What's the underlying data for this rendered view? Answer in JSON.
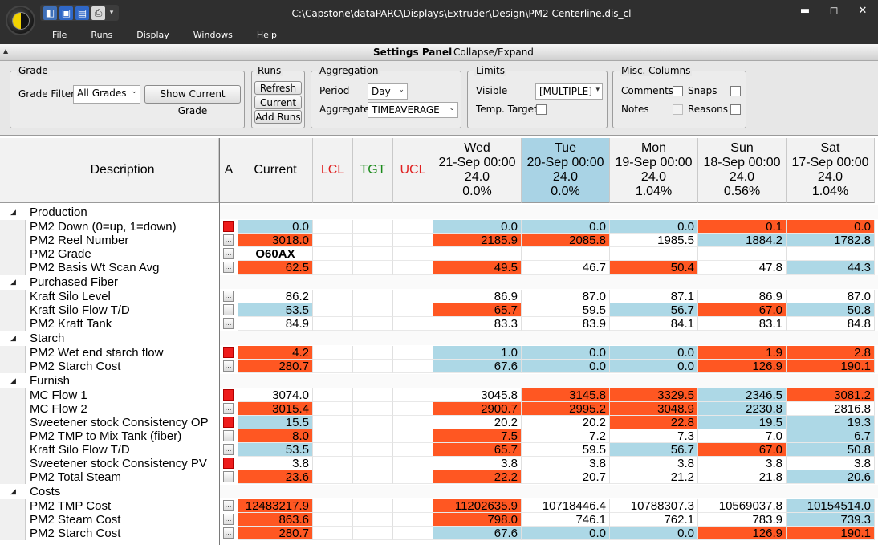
{
  "window": {
    "title": "C:\\Capstone\\dataPARC\\Displays\\Extruder\\Design\\PM2 Centerline.dis_cl",
    "menu": [
      "File",
      "Runs",
      "Display",
      "Windows",
      "Help"
    ],
    "controls": {
      "minimize": "▬",
      "restore": "◻",
      "close": "✕"
    }
  },
  "settings": {
    "title": "Settings Panel",
    "collapse_label": "Collapse/Expand",
    "grade": {
      "title": "Grade",
      "filter_label": "Grade Filter",
      "filter_value": "All Grades",
      "show_current": "Show Current Grade"
    },
    "runs": {
      "title": "Runs",
      "refresh": "Refresh",
      "current": "Current",
      "add_runs": "Add Runs"
    },
    "aggregation": {
      "title": "Aggregation",
      "period_label": "Period",
      "period_value": "Day",
      "aggregate_label": "Aggregate",
      "aggregate_value": "TIMEAVERAGE"
    },
    "limits": {
      "title": "Limits",
      "visible_label": "Visible",
      "visible_value": "[MULTIPLE]",
      "temp_target_label": "Temp. Target"
    },
    "misc": {
      "title": "Misc. Columns",
      "comments": "Comments",
      "snaps": "Snaps",
      "notes": "Notes",
      "reasons": "Reasons"
    }
  },
  "grid": {
    "headers": {
      "description": "Description",
      "a": "A",
      "current": "Current",
      "lcl": "LCL",
      "tgt": "TGT",
      "ucl": "UCL"
    },
    "header_colors": {
      "lcl": "#e02020",
      "tgt": "#1a8a1a",
      "ucl": "#e02020"
    },
    "days": [
      {
        "day": "Wed",
        "date": "21-Sep 00:00",
        "hours": "24.0",
        "pct": "0.0%",
        "selected": false
      },
      {
        "day": "Tue",
        "date": "20-Sep 00:00",
        "hours": "24.0",
        "pct": "0.0%",
        "selected": true
      },
      {
        "day": "Mon",
        "date": "19-Sep 00:00",
        "hours": "24.0",
        "pct": "1.04%",
        "selected": false
      },
      {
        "day": "Sun",
        "date": "18-Sep 00:00",
        "hours": "24.0",
        "pct": "0.56%",
        "selected": false
      },
      {
        "day": "Sat",
        "date": "17-Sep 00:00",
        "hours": "24.0",
        "pct": "1.04%",
        "selected": false
      }
    ],
    "groups": [
      {
        "name": "Production",
        "rows": [
          {
            "desc": "PM2 Down (0=up, 1=down)",
            "a": "red",
            "current": {
              "v": "0.0",
              "c": "blue"
            },
            "days": [
              [
                "0.0",
                "blue"
              ],
              [
                "0.0",
                "blue"
              ],
              [
                "0.0",
                "blue"
              ],
              [
                "0.1",
                "orange"
              ],
              [
                "0.0",
                "orange"
              ]
            ]
          },
          {
            "desc": "PM2 Reel Number",
            "a": "btn",
            "current": {
              "v": "3018.0",
              "c": "orange"
            },
            "days": [
              [
                "2185.9",
                "orange"
              ],
              [
                "2085.8",
                "orange"
              ],
              [
                "1985.5",
                "white"
              ],
              [
                "1884.2",
                "blue"
              ],
              [
                "1782.8",
                "blue"
              ]
            ]
          },
          {
            "desc": "PM2 Grade",
            "a": "btn",
            "current": {
              "v": "O60AX",
              "c": "white",
              "bold": true,
              "center": true
            },
            "days": [
              [
                "",
                "white"
              ],
              [
                "",
                "white"
              ],
              [
                "",
                "white"
              ],
              [
                "",
                "white"
              ],
              [
                "",
                "white"
              ]
            ]
          },
          {
            "desc": "PM2 Basis Wt Scan Avg",
            "a": "btn",
            "current": {
              "v": "62.5",
              "c": "orange"
            },
            "days": [
              [
                "49.5",
                "orange"
              ],
              [
                "46.7",
                "white"
              ],
              [
                "50.4",
                "orange"
              ],
              [
                "47.8",
                "white"
              ],
              [
                "44.3",
                "blue"
              ]
            ]
          }
        ]
      },
      {
        "name": "Purchased Fiber",
        "rows": [
          {
            "desc": "Kraft Silo Level",
            "a": "btn",
            "current": {
              "v": "86.2",
              "c": "white"
            },
            "days": [
              [
                "86.9",
                "white"
              ],
              [
                "87.0",
                "white"
              ],
              [
                "87.1",
                "white"
              ],
              [
                "86.9",
                "white"
              ],
              [
                "87.0",
                "white"
              ]
            ]
          },
          {
            "desc": "Kraft Silo Flow T/D",
            "a": "btn",
            "current": {
              "v": "53.5",
              "c": "blue"
            },
            "days": [
              [
                "65.7",
                "orange"
              ],
              [
                "59.5",
                "white"
              ],
              [
                "56.7",
                "blue"
              ],
              [
                "67.0",
                "orange"
              ],
              [
                "50.8",
                "blue"
              ]
            ]
          },
          {
            "desc": "PM2 Kraft Tank",
            "a": "btn",
            "current": {
              "v": "84.9",
              "c": "white"
            },
            "days": [
              [
                "83.3",
                "white"
              ],
              [
                "83.9",
                "white"
              ],
              [
                "84.1",
                "white"
              ],
              [
                "83.1",
                "white"
              ],
              [
                "84.8",
                "white"
              ]
            ]
          }
        ]
      },
      {
        "name": "Starch",
        "rows": [
          {
            "desc": "PM2 Wet end starch flow",
            "a": "red",
            "current": {
              "v": "4.2",
              "c": "orange"
            },
            "days": [
              [
                "1.0",
                "blue"
              ],
              [
                "0.0",
                "blue"
              ],
              [
                "0.0",
                "blue"
              ],
              [
                "1.9",
                "orange"
              ],
              [
                "2.8",
                "orange"
              ]
            ]
          },
          {
            "desc": "PM2 Starch Cost",
            "a": "btn",
            "current": {
              "v": "280.7",
              "c": "orange"
            },
            "days": [
              [
                "67.6",
                "blue"
              ],
              [
                "0.0",
                "blue"
              ],
              [
                "0.0",
                "blue"
              ],
              [
                "126.9",
                "orange"
              ],
              [
                "190.1",
                "orange"
              ]
            ]
          }
        ]
      },
      {
        "name": "Furnish",
        "rows": [
          {
            "desc": "MC Flow 1",
            "a": "red",
            "current": {
              "v": "3074.0",
              "c": "white"
            },
            "days": [
              [
                "3045.8",
                "white"
              ],
              [
                "3145.8",
                "orange"
              ],
              [
                "3329.5",
                "orange"
              ],
              [
                "2346.5",
                "blue"
              ],
              [
                "3081.2",
                "orange"
              ]
            ]
          },
          {
            "desc": "MC Flow 2",
            "a": "btn",
            "current": {
              "v": "3015.4",
              "c": "orange"
            },
            "days": [
              [
                "2900.7",
                "orange"
              ],
              [
                "2995.2",
                "orange"
              ],
              [
                "3048.9",
                "orange"
              ],
              [
                "2230.8",
                "blue"
              ],
              [
                "2816.8",
                "white"
              ]
            ]
          },
          {
            "desc": "Sweetener stock Consistency OP",
            "a": "red",
            "current": {
              "v": "15.5",
              "c": "blue"
            },
            "days": [
              [
                "20.2",
                "white"
              ],
              [
                "20.2",
                "white"
              ],
              [
                "22.8",
                "orange"
              ],
              [
                "19.5",
                "blue"
              ],
              [
                "19.3",
                "blue"
              ]
            ]
          },
          {
            "desc": "PM2 TMP to Mix Tank (fiber)",
            "a": "btn",
            "current": {
              "v": "8.0",
              "c": "orange"
            },
            "days": [
              [
                "7.5",
                "orange"
              ],
              [
                "7.2",
                "white"
              ],
              [
                "7.3",
                "white"
              ],
              [
                "7.0",
                "white"
              ],
              [
                "6.7",
                "blue"
              ]
            ]
          },
          {
            "desc": "Kraft Silo Flow T/D",
            "a": "btn",
            "current": {
              "v": "53.5",
              "c": "blue"
            },
            "days": [
              [
                "65.7",
                "orange"
              ],
              [
                "59.5",
                "white"
              ],
              [
                "56.7",
                "blue"
              ],
              [
                "67.0",
                "orange"
              ],
              [
                "50.8",
                "blue"
              ]
            ]
          },
          {
            "desc": "Sweetener stock Consistency PV",
            "a": "red",
            "current": {
              "v": "3.8",
              "c": "white"
            },
            "days": [
              [
                "3.8",
                "white"
              ],
              [
                "3.8",
                "white"
              ],
              [
                "3.8",
                "white"
              ],
              [
                "3.8",
                "white"
              ],
              [
                "3.8",
                "white"
              ]
            ]
          },
          {
            "desc": "PM2 Total Steam",
            "a": "btn",
            "current": {
              "v": "23.6",
              "c": "orange"
            },
            "days": [
              [
                "22.2",
                "orange"
              ],
              [
                "20.7",
                "white"
              ],
              [
                "21.2",
                "white"
              ],
              [
                "21.8",
                "white"
              ],
              [
                "20.6",
                "blue"
              ]
            ]
          }
        ]
      },
      {
        "name": "Costs",
        "rows": [
          {
            "desc": "PM2 TMP Cost",
            "a": "btn",
            "current": {
              "v": "12483217.9",
              "c": "orange"
            },
            "days": [
              [
                "11202635.9",
                "orange"
              ],
              [
                "10718446.4",
                "white"
              ],
              [
                "10788307.3",
                "white"
              ],
              [
                "10569037.8",
                "white"
              ],
              [
                "10154514.0",
                "blue"
              ]
            ]
          },
          {
            "desc": "PM2 Steam Cost",
            "a": "btn",
            "current": {
              "v": "863.6",
              "c": "orange"
            },
            "days": [
              [
                "798.0",
                "orange"
              ],
              [
                "746.1",
                "white"
              ],
              [
                "762.1",
                "white"
              ],
              [
                "783.9",
                "white"
              ],
              [
                "739.3",
                "blue"
              ]
            ]
          },
          {
            "desc": "PM2 Starch Cost",
            "a": "btn",
            "current": {
              "v": "280.7",
              "c": "orange"
            },
            "days": [
              [
                "67.6",
                "blue"
              ],
              [
                "0.0",
                "blue"
              ],
              [
                "0.0",
                "blue"
              ],
              [
                "126.9",
                "orange"
              ],
              [
                "190.1",
                "orange"
              ]
            ]
          }
        ]
      }
    ]
  }
}
